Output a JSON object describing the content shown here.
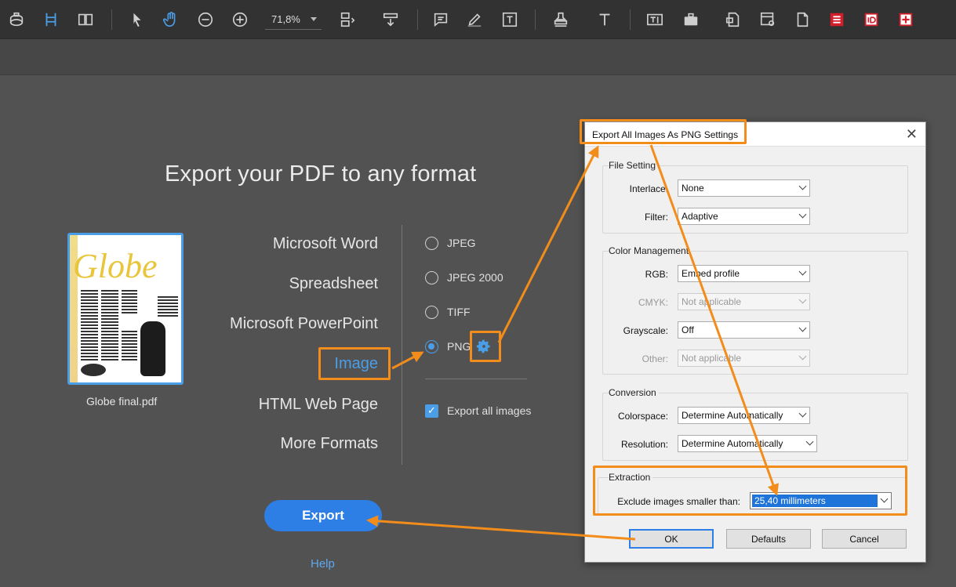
{
  "toolbar": {
    "zoom_value": "71,8%",
    "icons": [
      "print-icon",
      "single-page-icon",
      "two-page-icon",
      "select-icon",
      "hand-icon",
      "zoom-out-icon",
      "zoom-in-icon",
      "page-layout-icon",
      "insert-page-icon",
      "comment-icon",
      "highlight-pen-icon",
      "text-box-icon",
      "stamp-icon",
      "text-icon",
      "text-field-icon",
      "toolbox-icon",
      "page-settings-icon",
      "page-options-icon",
      "document-icon",
      "form-icon",
      "id-icon",
      "add-icon"
    ]
  },
  "export_panel": {
    "headline": "Export your PDF to any format",
    "file_name": "Globe final.pdf",
    "thumbnail_title": "Globe",
    "formats": [
      "Microsoft Word",
      "Spreadsheet",
      "Microsoft PowerPoint",
      "Image",
      "HTML Web Page",
      "More Formats"
    ],
    "active_format": "Image",
    "image_options": [
      "JPEG",
      "JPEG 2000",
      "TIFF",
      "PNG"
    ],
    "selected_option": "PNG",
    "export_all_label": "Export all images",
    "export_all_checked": true,
    "export_button": "Export",
    "help_link": "Help"
  },
  "dialog": {
    "title": "Export All Images As PNG Settings",
    "close": "✕",
    "file_setting": {
      "label": "File Setting",
      "interlace_label": "Interlace:",
      "interlace_value": "None",
      "filter_label": "Filter:",
      "filter_value": "Adaptive"
    },
    "color_management": {
      "label": "Color Management",
      "rgb_label": "RGB:",
      "rgb_value": "Embed profile",
      "cmyk_label": "CMYK:",
      "cmyk_value": "Not applicable",
      "grayscale_label": "Grayscale:",
      "grayscale_value": "Off",
      "other_label": "Other:",
      "other_value": "Not applicable"
    },
    "conversion": {
      "label": "Conversion",
      "colorspace_label": "Colorspace:",
      "colorspace_value": "Determine Automatically",
      "resolution_label": "Resolution:",
      "resolution_value": "Determine Automatically"
    },
    "extraction": {
      "label": "Extraction",
      "exclude_label": "Exclude images smaller than:",
      "exclude_value": "25,40 millimeters"
    },
    "buttons": {
      "ok": "OK",
      "defaults": "Defaults",
      "cancel": "Cancel"
    }
  },
  "colors": {
    "accent": "#4a9ee8",
    "highlight": "#f28c1b",
    "export_button": "#2d7ee5"
  }
}
